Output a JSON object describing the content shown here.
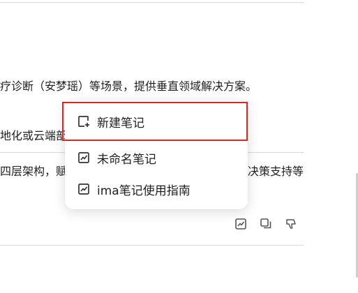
{
  "background": {
    "line1": "疗诊断（安梦瑶）等场景，提供垂直领域解决方案。",
    "line2": "地化或云端部",
    "line3_left": "四层架构，赋",
    "line3_right": "决策支持等"
  },
  "menu": {
    "items": [
      {
        "label": "新建笔记",
        "icon": "new-note-icon"
      },
      {
        "label": "未命名笔记",
        "icon": "note-icon"
      },
      {
        "label": "ima笔记使用指南",
        "icon": "note-icon"
      }
    ]
  },
  "message_actions": [
    "save-note-icon",
    "copy-icon",
    "dislike-icon"
  ],
  "colors": {
    "highlight": "#e0261a",
    "text": "#1f1f1f",
    "icon": "#555555",
    "divider": "#d9d9d9"
  }
}
